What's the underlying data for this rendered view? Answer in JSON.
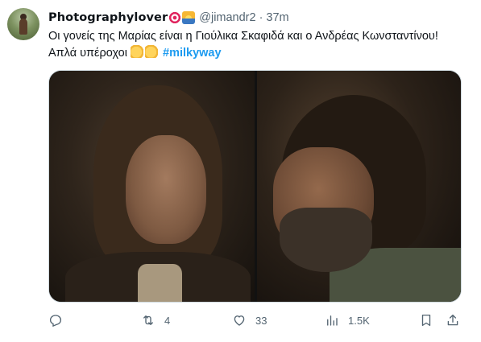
{
  "tweet": {
    "display_name": "Photographylover",
    "name_emojis": [
      "target-emoji",
      "sunset-emoji"
    ],
    "handle": "@jimandr2",
    "separator": "·",
    "time": "37m",
    "text_line1": "Οι γονείς της Μαρίας είναι η Γιούλικα Σκαφιδά και ο Ανδρέας Κωνσταντίνου!",
    "text_line2": "Απλά υπέροχοι",
    "text_emojis": [
      "clapping-hands-emoji",
      "clapping-hands-emoji"
    ],
    "hashtag": "#milkyway"
  },
  "actions": {
    "reply": {
      "icon": "reply-icon",
      "count": ""
    },
    "retweet": {
      "icon": "retweet-icon",
      "count": "4"
    },
    "like": {
      "icon": "heart-icon",
      "count": "33"
    },
    "views": {
      "icon": "views-chart-icon",
      "count": "1.5K"
    },
    "bookmark": {
      "icon": "bookmark-icon"
    },
    "share": {
      "icon": "share-icon"
    }
  },
  "colors": {
    "text": "#0f1419",
    "secondary": "#536471",
    "link": "#1d9bf0",
    "border": "#cfd9de"
  }
}
